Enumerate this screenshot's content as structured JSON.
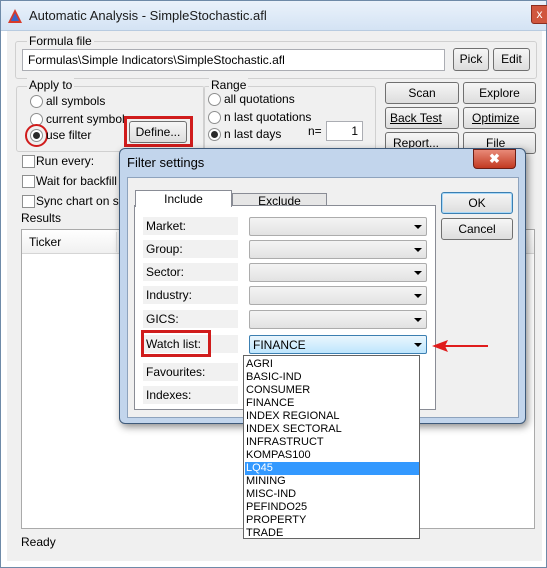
{
  "window": {
    "title": "Automatic Analysis - SimpleStochastic.afl",
    "close_glyph": "x"
  },
  "formula": {
    "label": "Formula file",
    "path": "Formulas\\Simple Indicators\\SimpleStochastic.afl",
    "pick": "Pick",
    "edit": "Edit"
  },
  "apply_to": {
    "label": "Apply to",
    "all_symbols": "all symbols",
    "current_symbol": "current symbol",
    "use_filter": "use filter",
    "selected": "use filter",
    "define": "Define..."
  },
  "range": {
    "label": "Range",
    "all_quotations": "all quotations",
    "n_last_quotations": "n last quotations",
    "n_last_days": "n last days",
    "selected": "n last days",
    "n_label": "n=",
    "n_value": "1"
  },
  "actions": {
    "scan": "Scan",
    "explore": "Explore",
    "back_test": "Back Test",
    "optimize": "Optimize",
    "report": "Report...",
    "file": "File"
  },
  "options": {
    "run_every": "Run every:",
    "wait_backfill": "Wait for backfill (R",
    "sync_chart": "Sync chart on sele"
  },
  "results": {
    "label": "Results",
    "col_ticker": "Ticker"
  },
  "status": {
    "text": "Ready"
  },
  "dialog": {
    "title": "Filter settings",
    "close_glyph": "✖",
    "tabs": {
      "include": "Include",
      "exclude": "Exclude"
    },
    "ok": "OK",
    "cancel": "Cancel",
    "fields": {
      "market": "Market:",
      "group": "Group:",
      "sector": "Sector:",
      "industry": "Industry:",
      "gics": "GICS:",
      "watch_list": "Watch list:",
      "favourites": "Favourites:",
      "indexes": "Indexes:"
    },
    "watch_list_value": "FINANCE",
    "watch_list_options": [
      "AGRI",
      "BASIC-IND",
      "CONSUMER",
      "FINANCE",
      "INDEX REGIONAL",
      "INDEX SECTORAL",
      "INFRASTRUCT",
      "KOMPAS100",
      "LQ45",
      "MINING",
      "MISC-IND",
      "PEFINDO25",
      "PROPERTY",
      "TRADE"
    ],
    "highlighted_option": "LQ45"
  },
  "colors": {
    "highlight_red": "#d01c1c",
    "selection_blue": "#3399ff",
    "dialog_frame": "#c2d5ec"
  },
  "icons": {
    "app": "amibroker-app-icon",
    "arrow": "red-arrow-annotation"
  }
}
